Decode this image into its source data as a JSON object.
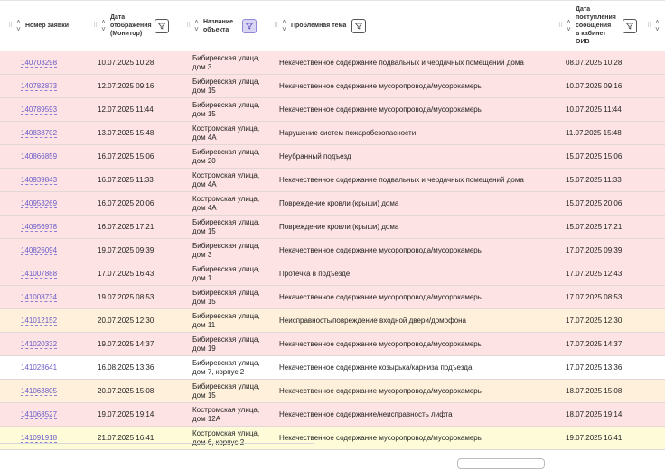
{
  "header": {
    "col_id": "Номер заявки",
    "col_display_date": [
      "Дата",
      "отображения",
      "(Монитор)"
    ],
    "col_object": [
      "Название",
      "объекта"
    ],
    "col_theme": "Проблемная тема",
    "col_received": [
      "Дата",
      "поступления",
      "сообщения",
      "в кабинет",
      "ОИВ"
    ]
  },
  "row_colors": {
    "pink": "#fde3e3",
    "peach": "#fff0dc",
    "white": "#ffffff",
    "yellow": "#fdfbd8"
  },
  "rows": [
    {
      "id": "140703298",
      "date": "10.07.2025 10:28",
      "addr1": "Бибиревская улица,",
      "addr2": "дом 3",
      "theme": "Некачественное содержание подвальных и чердачных помещений дома",
      "received": "08.07.2025 10:28",
      "color": "pink"
    },
    {
      "id": "140782873",
      "date": "12.07.2025 09:16",
      "addr1": "Бибиревская улица,",
      "addr2": "дом 15",
      "theme": "Некачественное содержание мусоропровода/мусорокамеры",
      "received": "10.07.2025 09:16",
      "color": "pink"
    },
    {
      "id": "140789593",
      "date": "12.07.2025 11:44",
      "addr1": "Бибиревская улица,",
      "addr2": "дом 15",
      "theme": "Некачественное содержание мусоропровода/мусорокамеры",
      "received": "10.07.2025 11:44",
      "color": "pink"
    },
    {
      "id": "140838702",
      "date": "13.07.2025 15:48",
      "addr1": "Костромская улица,",
      "addr2": "дом 4А",
      "theme": "Нарушение систем пожаробезопасности",
      "received": "11.07.2025 15:48",
      "color": "pink"
    },
    {
      "id": "140866859",
      "date": "16.07.2025 15:06",
      "addr1": "Бибиревская улица,",
      "addr2": "дом 20",
      "theme": "Неубранный подъезд",
      "received": "15.07.2025 15:06",
      "color": "pink"
    },
    {
      "id": "140939843",
      "date": "16.07.2025 11:33",
      "addr1": "Костромская улица,",
      "addr2": "дом 4А",
      "theme": "Некачественное содержание подвальных и чердачных помещений дома",
      "received": "15.07.2025 11:33",
      "color": "pink"
    },
    {
      "id": "140953269",
      "date": "16.07.2025 20:06",
      "addr1": "Костромская улица,",
      "addr2": "дом 4А",
      "theme": "Повреждение кровли (крыши) дома",
      "received": "15.07.2025 20:06",
      "color": "pink"
    },
    {
      "id": "140956978",
      "date": "16.07.2025 17:21",
      "addr1": "Бибиревская улица,",
      "addr2": "дом 15",
      "theme": "Повреждение кровли (крыши) дома",
      "received": "15.07.2025 17:21",
      "color": "pink"
    },
    {
      "id": "140826094",
      "date": "19.07.2025 09:39",
      "addr1": "Бибиревская улица,",
      "addr2": "дом 3",
      "theme": "Некачественное содержание мусоропровода/мусорокамеры",
      "received": "17.07.2025 09:39",
      "color": "pink"
    },
    {
      "id": "141007888",
      "date": "17.07.2025 16:43",
      "addr1": "Бибиревская улица,",
      "addr2": "дом 1",
      "theme": "Протечка в подъезде",
      "received": "17.07.2025 12:43",
      "color": "pink"
    },
    {
      "id": "141008734",
      "date": "19.07.2025 08:53",
      "addr1": "Бибиревская улица,",
      "addr2": "дом 15",
      "theme": "Некачественное содержание мусоропровода/мусорокамеры",
      "received": "17.07.2025 08:53",
      "color": "pink"
    },
    {
      "id": "141012152",
      "date": "20.07.2025 12:30",
      "addr1": "Бибиревская улица,",
      "addr2": "дом 11",
      "theme": "Неисправность/повреждение входной двери/домофона",
      "received": "17.07.2025 12:30",
      "color": "peach"
    },
    {
      "id": "141020332",
      "date": "19.07.2025 14:37",
      "addr1": "Бибиревская улица,",
      "addr2": "дом 19",
      "theme": "Некачественное содержание мусоропровода/мусорокамеры",
      "received": "17.07.2025 14:37",
      "color": "pink"
    },
    {
      "id": "141028641",
      "date": "16.08.2025 13:36",
      "addr1": "Бибиревская улица,",
      "addr2": "дом 7, корпус 2",
      "theme": "Некачественное содержание козырька/карниза подъезда",
      "received": "17.07.2025 13:36",
      "color": "white"
    },
    {
      "id": "141063805",
      "date": "20.07.2025 15:08",
      "addr1": "Бибиревская улица,",
      "addr2": "дом 15",
      "theme": "Некачественное содержание мусоропровода/мусорокамеры",
      "received": "18.07.2025 15:08",
      "color": "peach"
    },
    {
      "id": "141068527",
      "date": "19.07.2025 19:14",
      "addr1": "Костромская улица,",
      "addr2": "дом 12А",
      "theme": "Некачественное содержание/неисправность лифта",
      "received": "18.07.2025 19:14",
      "color": "pink"
    },
    {
      "id": "141091918",
      "date": "21.07.2025 16:41",
      "addr1": "Костромская улица,",
      "addr2": "дом 6, корпус 2",
      "theme": "Некачественное содержание мусоропровода/мусорокамеры",
      "received": "19.07.2025 16:41",
      "color": "yellow"
    }
  ]
}
